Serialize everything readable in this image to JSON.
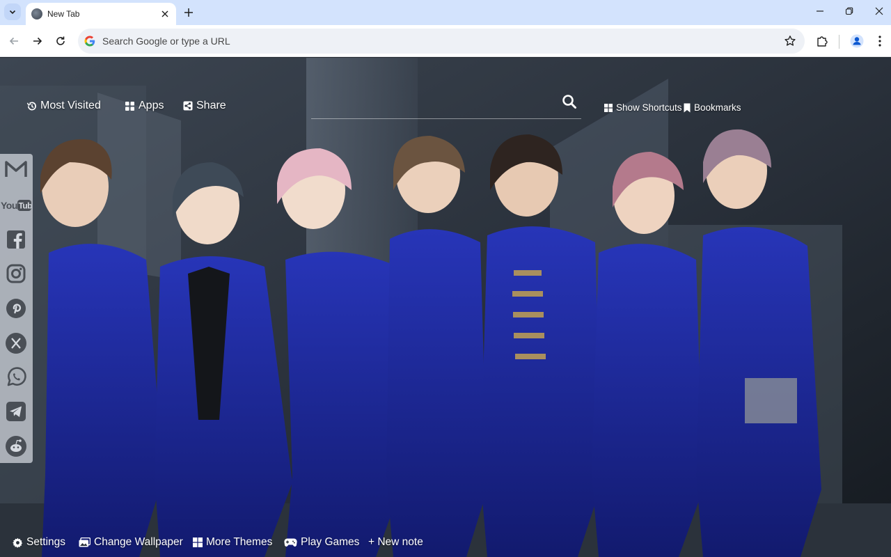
{
  "browser": {
    "tab": {
      "title": "New Tab"
    },
    "omnibox": {
      "placeholder": "Search Google or type a URL"
    }
  },
  "newtab": {
    "top_links": [
      {
        "label": "Most Visited",
        "icon": "history-icon"
      },
      {
        "label": "Apps",
        "icon": "apps-grid-icon"
      },
      {
        "label": "Share",
        "icon": "share-icon"
      }
    ],
    "search": {
      "icon": "search-icon",
      "value": ""
    },
    "right_links": [
      {
        "label": "Show Shortcuts",
        "icon": "windows-grid-icon"
      },
      {
        "label": "Bookmarks",
        "icon": "bookmark-icon"
      }
    ],
    "social": [
      {
        "name": "gmail-icon",
        "label": "M"
      },
      {
        "name": "youtube-icon",
        "label": "YouTube"
      },
      {
        "name": "facebook-icon",
        "label": "f"
      },
      {
        "name": "instagram-icon",
        "label": ""
      },
      {
        "name": "pinterest-icon",
        "label": "P"
      },
      {
        "name": "x-icon",
        "label": "X"
      },
      {
        "name": "whatsapp-icon",
        "label": ""
      },
      {
        "name": "telegram-icon",
        "label": ""
      },
      {
        "name": "reddit-icon",
        "label": ""
      }
    ],
    "bottom_links": [
      {
        "label": "Settings",
        "icon": "gear-icon"
      },
      {
        "label": "Change Wallpaper",
        "icon": "wallpaper-icon"
      },
      {
        "label": "More Themes",
        "icon": "windows-grid-icon"
      },
      {
        "label": "Play Games",
        "icon": "gamepad-icon"
      },
      {
        "label": "+ New note",
        "icon": ""
      }
    ]
  },
  "colors": {
    "tabstrip": "#d3e3fd",
    "toolbar": "#ffffff",
    "omnibox": "#eef1f6",
    "wallpaper_dark": "#1d232b",
    "jacket_blue": "#1e2a9e"
  }
}
